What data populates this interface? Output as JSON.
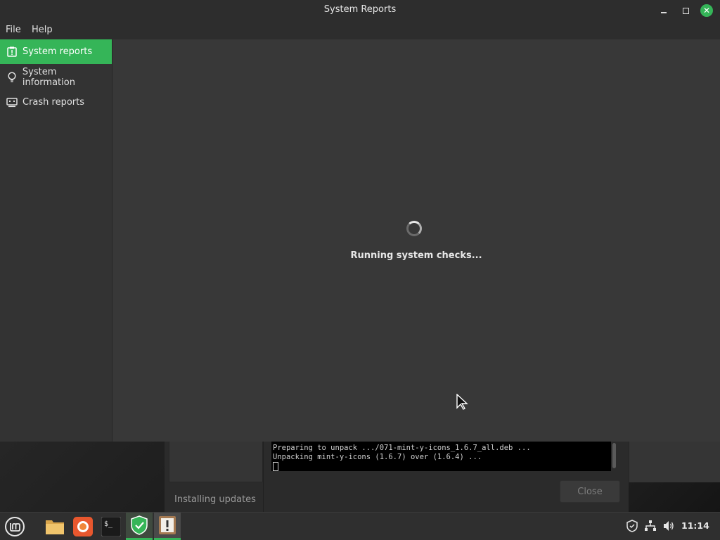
{
  "window": {
    "title": "System Reports",
    "menu": [
      "File",
      "Help"
    ]
  },
  "sidebar": {
    "items": [
      {
        "label": "System reports",
        "icon": "report-icon",
        "active": true
      },
      {
        "label": "System information",
        "icon": "lightbulb-icon",
        "active": false
      },
      {
        "label": "Crash reports",
        "icon": "crash-monitor-icon",
        "active": false
      }
    ]
  },
  "main": {
    "status": "Running system checks..."
  },
  "update_window": {
    "status": "Installing updates",
    "terminal_lines": [
      "Preparing to unpack .../071-mint-y-icons_1.6.7_all.deb ...",
      "Unpacking mint-y-icons (1.6.7) over (1.6.4) ..."
    ],
    "close_label": "Close"
  },
  "taskbar": {
    "apps": [
      "mint-menu-icon",
      "files-icon",
      "firefox-icon",
      "terminal-icon",
      "update-manager-icon",
      "system-reports-icon"
    ],
    "tray": [
      "shield-icon",
      "network-icon",
      "volume-icon"
    ],
    "clock": "11:14"
  },
  "colors": {
    "accent": "#35b558",
    "window_bg": "#383838",
    "sidebar_bg": "#333333"
  }
}
